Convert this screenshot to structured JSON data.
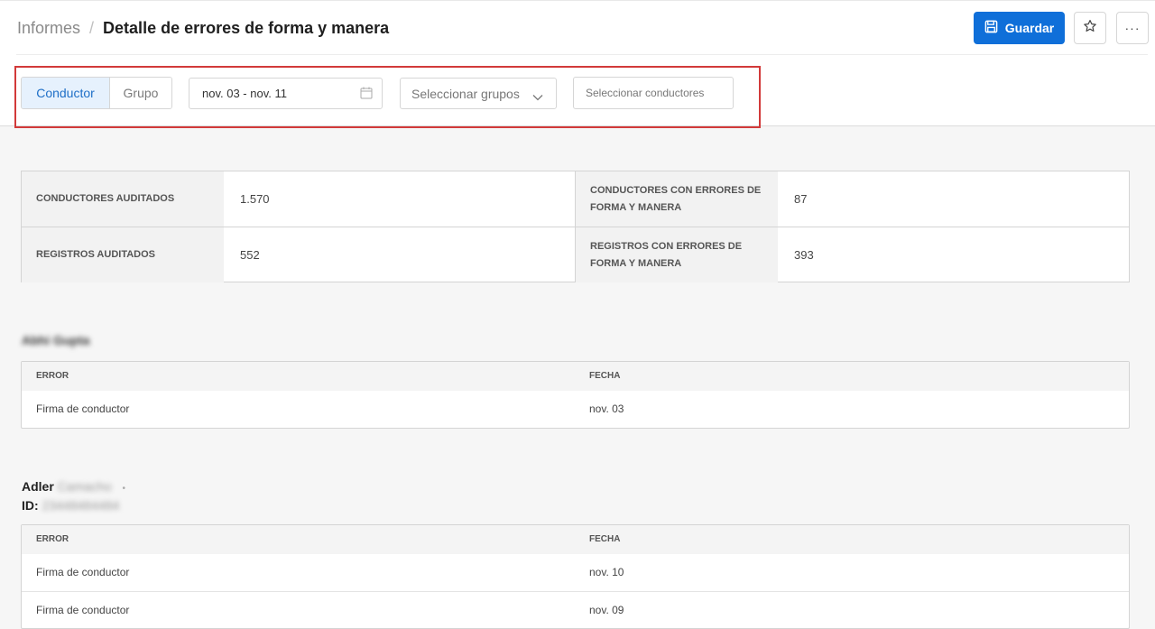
{
  "breadcrumb": {
    "root": "Informes",
    "separator": "/",
    "title": "Detalle de errores de forma y manera"
  },
  "toolbar": {
    "save_label": "Guardar",
    "more_label": "···"
  },
  "filters": {
    "segments": [
      "Conductor",
      "Grupo"
    ],
    "active_segment": "Conductor",
    "date_range": "nov. 03 - nov. 11",
    "groups_placeholder": "Seleccionar grupos",
    "drivers_placeholder": "Seleccionar conductores"
  },
  "summary": {
    "drivers_audited_label": "CONDUCTORES AUDITADOS",
    "drivers_audited_value": "1.570",
    "drivers_errors_label": "CONDUCTORES CON ERRORES DE FORMA Y MANERA",
    "drivers_errors_value": "87",
    "logs_audited_label": "REGISTROS AUDITADOS",
    "logs_audited_value": "552",
    "logs_errors_label": "REGISTROS CON ERRORES DE FORMA Y MANERA",
    "logs_errors_value": "393"
  },
  "drivers": [
    {
      "name": "Abhi Gupta",
      "columns": [
        "ERROR",
        "FECHA"
      ],
      "rows": [
        {
          "error": "Firma de conductor",
          "date": "nov. 03"
        }
      ]
    },
    {
      "first_name": "Adler",
      "last_name": "Camacho",
      "id_label": "ID:",
      "id_value": "23448484484",
      "columns": [
        "ERROR",
        "FECHA"
      ],
      "rows": [
        {
          "error": "Firma de conductor",
          "date": "nov. 10"
        },
        {
          "error": "Firma de conductor",
          "date": "nov. 09"
        }
      ]
    }
  ],
  "colors": {
    "accent": "#0f6fd9",
    "highlight_border": "#d23a3a",
    "active_segment_bg": "#e6f1fd"
  }
}
